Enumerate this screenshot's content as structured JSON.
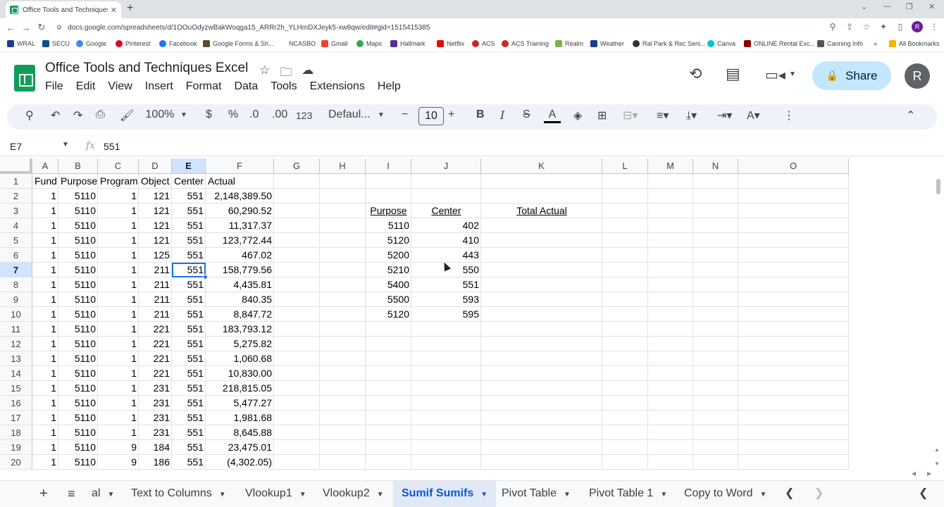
{
  "browser": {
    "tab_title": "Office Tools and Techniques Exce",
    "url": "docs.google.com/spreadsheets/d/1OOuOdyzwBakWoqga15_ARRr2h_YLHmDXJeyk5-xw8qw/edit#gid=1515415385",
    "profile_initial": "R",
    "bookmarks": [
      "WRAL",
      "SECU",
      "Google",
      "Pinterest",
      "Facebook",
      "Google Forms & Sh...",
      "NCASBO",
      "Gmail",
      "Maps",
      "Hallmark",
      "Netflix",
      "ACS",
      "ACS Training",
      "Realm",
      "Weather",
      "Ral Park & Rec Seni...",
      "Canva",
      "ONLINE Rental Exc...",
      "Canning Info"
    ],
    "all_bookmarks": "All Bookmarks"
  },
  "doc": {
    "title": "Office Tools and Techniques Excel",
    "menu": [
      "File",
      "Edit",
      "View",
      "Insert",
      "Format",
      "Data",
      "Tools",
      "Extensions",
      "Help"
    ],
    "share_label": "Share",
    "avatar_initial": "R"
  },
  "toolbar": {
    "zoom": "100%",
    "currency": "$",
    "percent": "%",
    "dec_decrease": ".0",
    "dec_increase": ".00",
    "number_format": "123",
    "font": "Defaul...",
    "font_size": "10",
    "bold": "B",
    "italic": "I",
    "strike": "S",
    "text_color": "A"
  },
  "formula_bar": {
    "name_box": "E7",
    "fx": "fx",
    "value": "551"
  },
  "columns": [
    "A",
    "B",
    "C",
    "D",
    "E",
    "F",
    "G",
    "H",
    "I",
    "J",
    "K",
    "L",
    "M",
    "N",
    "O"
  ],
  "headers": {
    "fund": "Fund",
    "purpose": "Purpose",
    "program": "Program",
    "object": "Object",
    "center": "Center",
    "actual": "Actual"
  },
  "rows": [
    {
      "fund": "1",
      "purpose": "5110",
      "program": "1",
      "object": "121",
      "center": "551",
      "actual": "2,148,389.50"
    },
    {
      "fund": "1",
      "purpose": "5110",
      "program": "1",
      "object": "121",
      "center": "551",
      "actual": "60,290.52"
    },
    {
      "fund": "1",
      "purpose": "5110",
      "program": "1",
      "object": "121",
      "center": "551",
      "actual": "11,317.37"
    },
    {
      "fund": "1",
      "purpose": "5110",
      "program": "1",
      "object": "121",
      "center": "551",
      "actual": "123,772.44"
    },
    {
      "fund": "1",
      "purpose": "5110",
      "program": "1",
      "object": "125",
      "center": "551",
      "actual": "467.02"
    },
    {
      "fund": "1",
      "purpose": "5110",
      "program": "1",
      "object": "211",
      "center": "551",
      "actual": "158,779.56"
    },
    {
      "fund": "1",
      "purpose": "5110",
      "program": "1",
      "object": "211",
      "center": "551",
      "actual": "4,435.81"
    },
    {
      "fund": "1",
      "purpose": "5110",
      "program": "1",
      "object": "211",
      "center": "551",
      "actual": "840.35"
    },
    {
      "fund": "1",
      "purpose": "5110",
      "program": "1",
      "object": "211",
      "center": "551",
      "actual": "8,847.72"
    },
    {
      "fund": "1",
      "purpose": "5110",
      "program": "1",
      "object": "221",
      "center": "551",
      "actual": "183,793.12"
    },
    {
      "fund": "1",
      "purpose": "5110",
      "program": "1",
      "object": "221",
      "center": "551",
      "actual": "5,275.82"
    },
    {
      "fund": "1",
      "purpose": "5110",
      "program": "1",
      "object": "221",
      "center": "551",
      "actual": "1,060.68"
    },
    {
      "fund": "1",
      "purpose": "5110",
      "program": "1",
      "object": "221",
      "center": "551",
      "actual": "10,830.00"
    },
    {
      "fund": "1",
      "purpose": "5110",
      "program": "1",
      "object": "231",
      "center": "551",
      "actual": "218,815.05"
    },
    {
      "fund": "1",
      "purpose": "5110",
      "program": "1",
      "object": "231",
      "center": "551",
      "actual": "5,477.27"
    },
    {
      "fund": "1",
      "purpose": "5110",
      "program": "1",
      "object": "231",
      "center": "551",
      "actual": "1,981.68"
    },
    {
      "fund": "1",
      "purpose": "5110",
      "program": "1",
      "object": "231",
      "center": "551",
      "actual": "8,645.88"
    },
    {
      "fund": "1",
      "purpose": "5110",
      "program": "9",
      "object": "184",
      "center": "551",
      "actual": "23,475.01"
    },
    {
      "fund": "1",
      "purpose": "5110",
      "program": "9",
      "object": "186",
      "center": "551",
      "actual": "(4,302.05)"
    }
  ],
  "summary": {
    "purpose_header": "Purpose",
    "center_header": "Center",
    "total_header": "Total Actual",
    "rows": [
      {
        "purpose": "5110",
        "center": "402"
      },
      {
        "purpose": "5120",
        "center": "410"
      },
      {
        "purpose": "5200",
        "center": "443"
      },
      {
        "purpose": "5210",
        "center": "550"
      },
      {
        "purpose": "5400",
        "center": "551"
      },
      {
        "purpose": "5500",
        "center": "593"
      },
      {
        "purpose": "5120",
        "center": "595"
      }
    ]
  },
  "sheet_tabs": [
    "al",
    "Text to Columns",
    "Vlookup1",
    "Vlookup2",
    "Sumif Sumifs",
    "Pivot Table",
    "Pivot Table 1",
    "Copy to Word"
  ],
  "active_sheet": "Sumif Sumifs"
}
